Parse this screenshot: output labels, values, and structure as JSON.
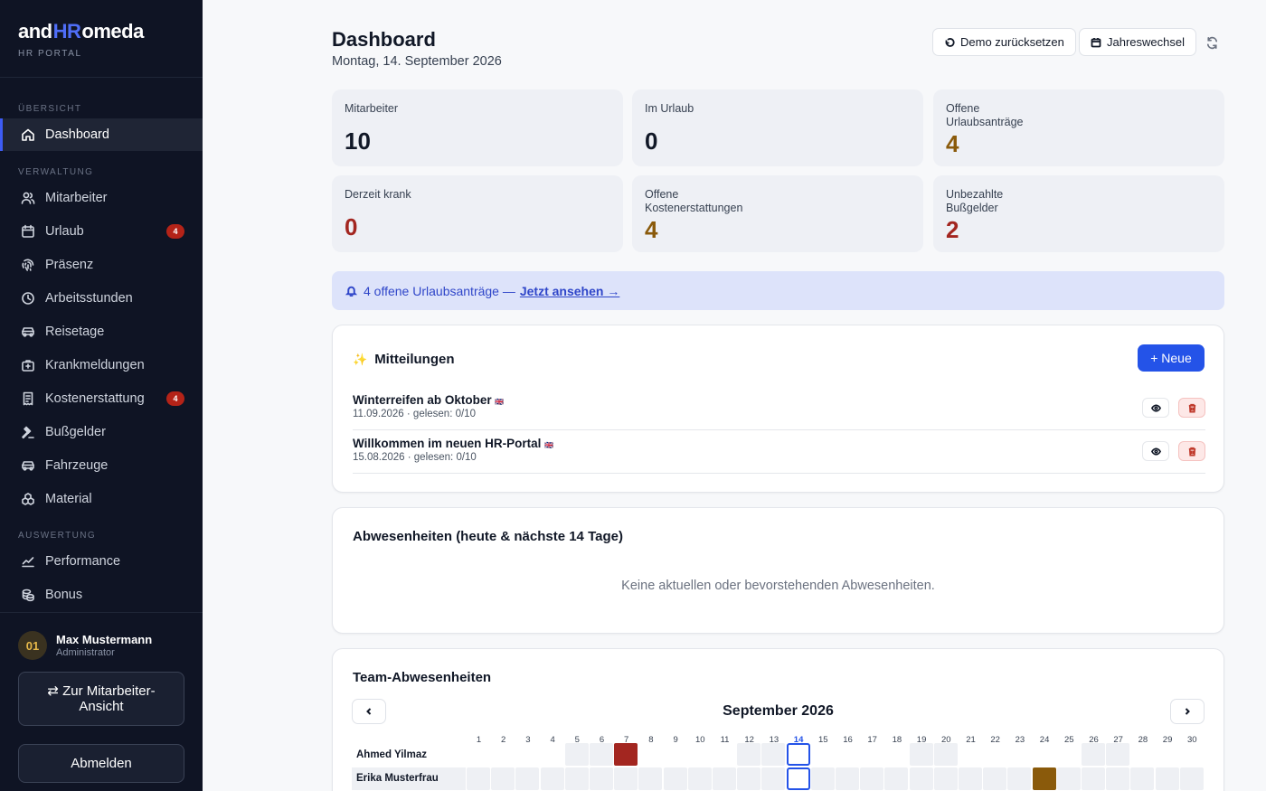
{
  "brand": {
    "prefix": "and",
    "highlight": "HR",
    "suffix": "omeda",
    "subtitle": "HR PORTAL"
  },
  "sidebar": {
    "sections": [
      "ÜBERSICHT",
      "VERWALTUNG",
      "AUSWERTUNG"
    ],
    "items": [
      {
        "label": "Dashboard",
        "icon": "home-icon"
      },
      {
        "label": "Mitarbeiter",
        "icon": "users-icon"
      },
      {
        "label": "Urlaub",
        "icon": "calendar-icon",
        "badge": "4"
      },
      {
        "label": "Präsenz",
        "icon": "fingerprint-icon"
      },
      {
        "label": "Arbeitsstunden",
        "icon": "clock-icon"
      },
      {
        "label": "Reisetage",
        "icon": "car-icon"
      },
      {
        "label": "Krankmeldungen",
        "icon": "medical-bag-icon"
      },
      {
        "label": "Kostenerstattung",
        "icon": "receipt-icon",
        "badge": "4"
      },
      {
        "label": "Bußgelder",
        "icon": "gavel-icon"
      },
      {
        "label": "Fahrzeuge",
        "icon": "car-icon"
      },
      {
        "label": "Material",
        "icon": "boxes-icon"
      },
      {
        "label": "Performance",
        "icon": "trend-icon"
      },
      {
        "label": "Bonus",
        "icon": "coins-icon"
      }
    ],
    "user": {
      "initials": "01",
      "name": "Max Mustermann",
      "role": "Administrator"
    },
    "switch_button": "⇄ Zur Mitarbeiter-Ansicht",
    "logout_button": "Abmelden"
  },
  "header": {
    "title": "Dashboard",
    "date": "Montag, 14. September 2026",
    "reset_button": "Demo zurücksetzen",
    "year_button": "Jahreswechsel"
  },
  "stats": [
    {
      "label": "Mitarbeiter",
      "value": "10",
      "color": "#111827"
    },
    {
      "label": "Im Urlaub",
      "value": "0",
      "color": "#111827"
    },
    {
      "label": "Offene Urlaubsanträge",
      "value": "4",
      "color": "#8a5a0b"
    },
    {
      "label": "Derzeit krank",
      "value": "0",
      "color": "#a32620"
    },
    {
      "label": "Offene Kostenerstattungen",
      "value": "4",
      "color": "#8a5a0b"
    },
    {
      "label": "Unbezahlte Bußgelder",
      "value": "2",
      "color": "#a32620"
    }
  ],
  "alert": {
    "text": "4 offene Urlaubsanträge —",
    "link": "Jetzt ansehen →"
  },
  "announcements": {
    "icon": "sparkles-icon",
    "title": "Mitteilungen",
    "new_button": "+  Neue",
    "items": [
      {
        "title": "Winterreifen ab Oktober",
        "flag": "🇬🇧",
        "meta": "11.09.2026 · gelesen: 0/10"
      },
      {
        "title": "Willkommen im neuen HR-Portal",
        "flag": "🇬🇧",
        "meta": "15.08.2026 · gelesen: 0/10"
      }
    ]
  },
  "absences": {
    "title": "Abwesenheiten (heute & nächste 14 Tage)",
    "empty": "Keine aktuellen oder bevorstehenden Abwesenheiten."
  },
  "team_calendar": {
    "title": "Team-Abwesenheiten",
    "month": "September 2026",
    "days": [
      "1",
      "2",
      "3",
      "4",
      "5",
      "6",
      "7",
      "8",
      "9",
      "10",
      "11",
      "12",
      "13",
      "14",
      "15",
      "16",
      "17",
      "18",
      "19",
      "20",
      "21",
      "22",
      "23",
      "24",
      "25",
      "26",
      "27",
      "28",
      "29",
      "30"
    ],
    "today": "14",
    "weekend_days": [
      5,
      6,
      12,
      13,
      19,
      20,
      26,
      27
    ],
    "rows": [
      {
        "name": "Ahmed Yilmaz",
        "marks": [
          {
            "day": 7,
            "color": "#a32620"
          }
        ]
      },
      {
        "name": "Erika Musterfrau",
        "marks": [
          {
            "day": 24,
            "color": "#8a5a0b"
          }
        ]
      }
    ],
    "colors": {
      "weekend": "#eef0f4",
      "workday_row2": "#eef0f4",
      "today_border": "#2453e8"
    }
  }
}
